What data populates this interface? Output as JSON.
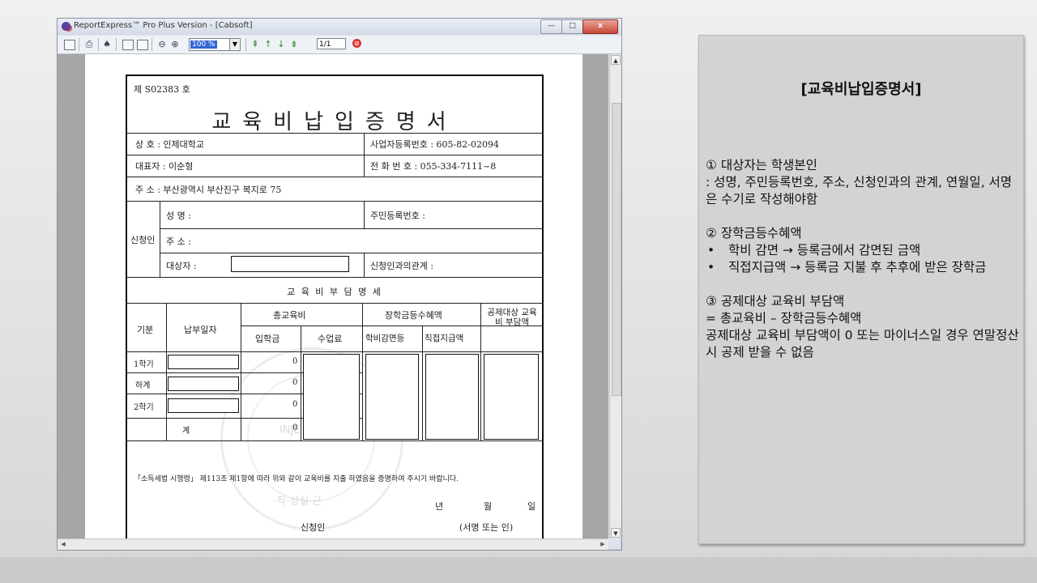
{
  "window": {
    "title": "ReportExpress™ Pro Plus Version - [Cabsoft]",
    "caption_min": "—",
    "caption_max": "□",
    "caption_close": "x"
  },
  "toolbar": {
    "zoom_value": "100 %",
    "page_value": "1/1"
  },
  "document": {
    "doc_no": "제 S02383 호",
    "title": "교육비납입증명서",
    "r1_left": "상 호 : 인제대학교",
    "r1_right": "사업자등록번호 : 605-82-02094",
    "r2_left": "대표자 : 이순형",
    "r2_right": "전 화 번 호 : 055-334-7111~8",
    "r3_left": "주 소 : 부산광역시 부산진구 복지로 75",
    "applicant_label": "신청인",
    "app_name": "성 명 :",
    "app_id": "주민등록번호 :",
    "app_addr": "주 소 :",
    "app_target": "대상자 :",
    "app_relation": "신청인과의관계 :",
    "detail_title": "교 육 비 부 담 명 세",
    "col_term": "기분",
    "col_paydate": "납부일자",
    "col_total": "총교육비",
    "col_entrance": "입학금",
    "col_tuition": "수업료",
    "col_scholar": "장학금등수혜액",
    "col_reduction": "학비감면등",
    "col_direct": "직접지급액",
    "col_deduct": "공제대상 교육비 부담액",
    "rows": [
      {
        "label": "1학기",
        "value": "0"
      },
      {
        "label": "하계",
        "value": "0"
      },
      {
        "label": "2학기",
        "value": "0"
      },
      {
        "label": "계",
        "value": "0"
      }
    ],
    "statement": "「소득세법 시행령」 제113조 제1항에 따라 위와 같이 교육비를 지출 하였음을 증명하여 주시기 바랍니다.",
    "year": "년",
    "month": "월",
    "day": "일",
    "sign_applicant": "신청인",
    "sign_note": "(서명 또는 인)",
    "seal_text_1": "INJE UNIV",
    "seal_text_2": "·직·성실·근"
  },
  "panel": {
    "title": "[교육비납입증명서]",
    "s1_head": "① 대상자는 학생본인",
    "s1_body": ": 성명, 주민등록번호, 주소, 신청인과의 관계, 연월일, 서명은 수기로 작성해야함",
    "s2_head": "② 장학금등수혜액",
    "s2_b1": "학비 감면 → 등록금에서 감면된 금액",
    "s2_b2": "직접지급액 → 등록금 지불 후 추후에 받은 장학금",
    "s3_head": "③ 공제대상 교육비 부담액",
    "s3_l1": "= 총교육비 – 장학금등수혜액",
    "s3_l2": "공제대상 교육비 부담액이 0 또는 마이너스일 경우 연말정산시 공제 받을 수 없음"
  }
}
